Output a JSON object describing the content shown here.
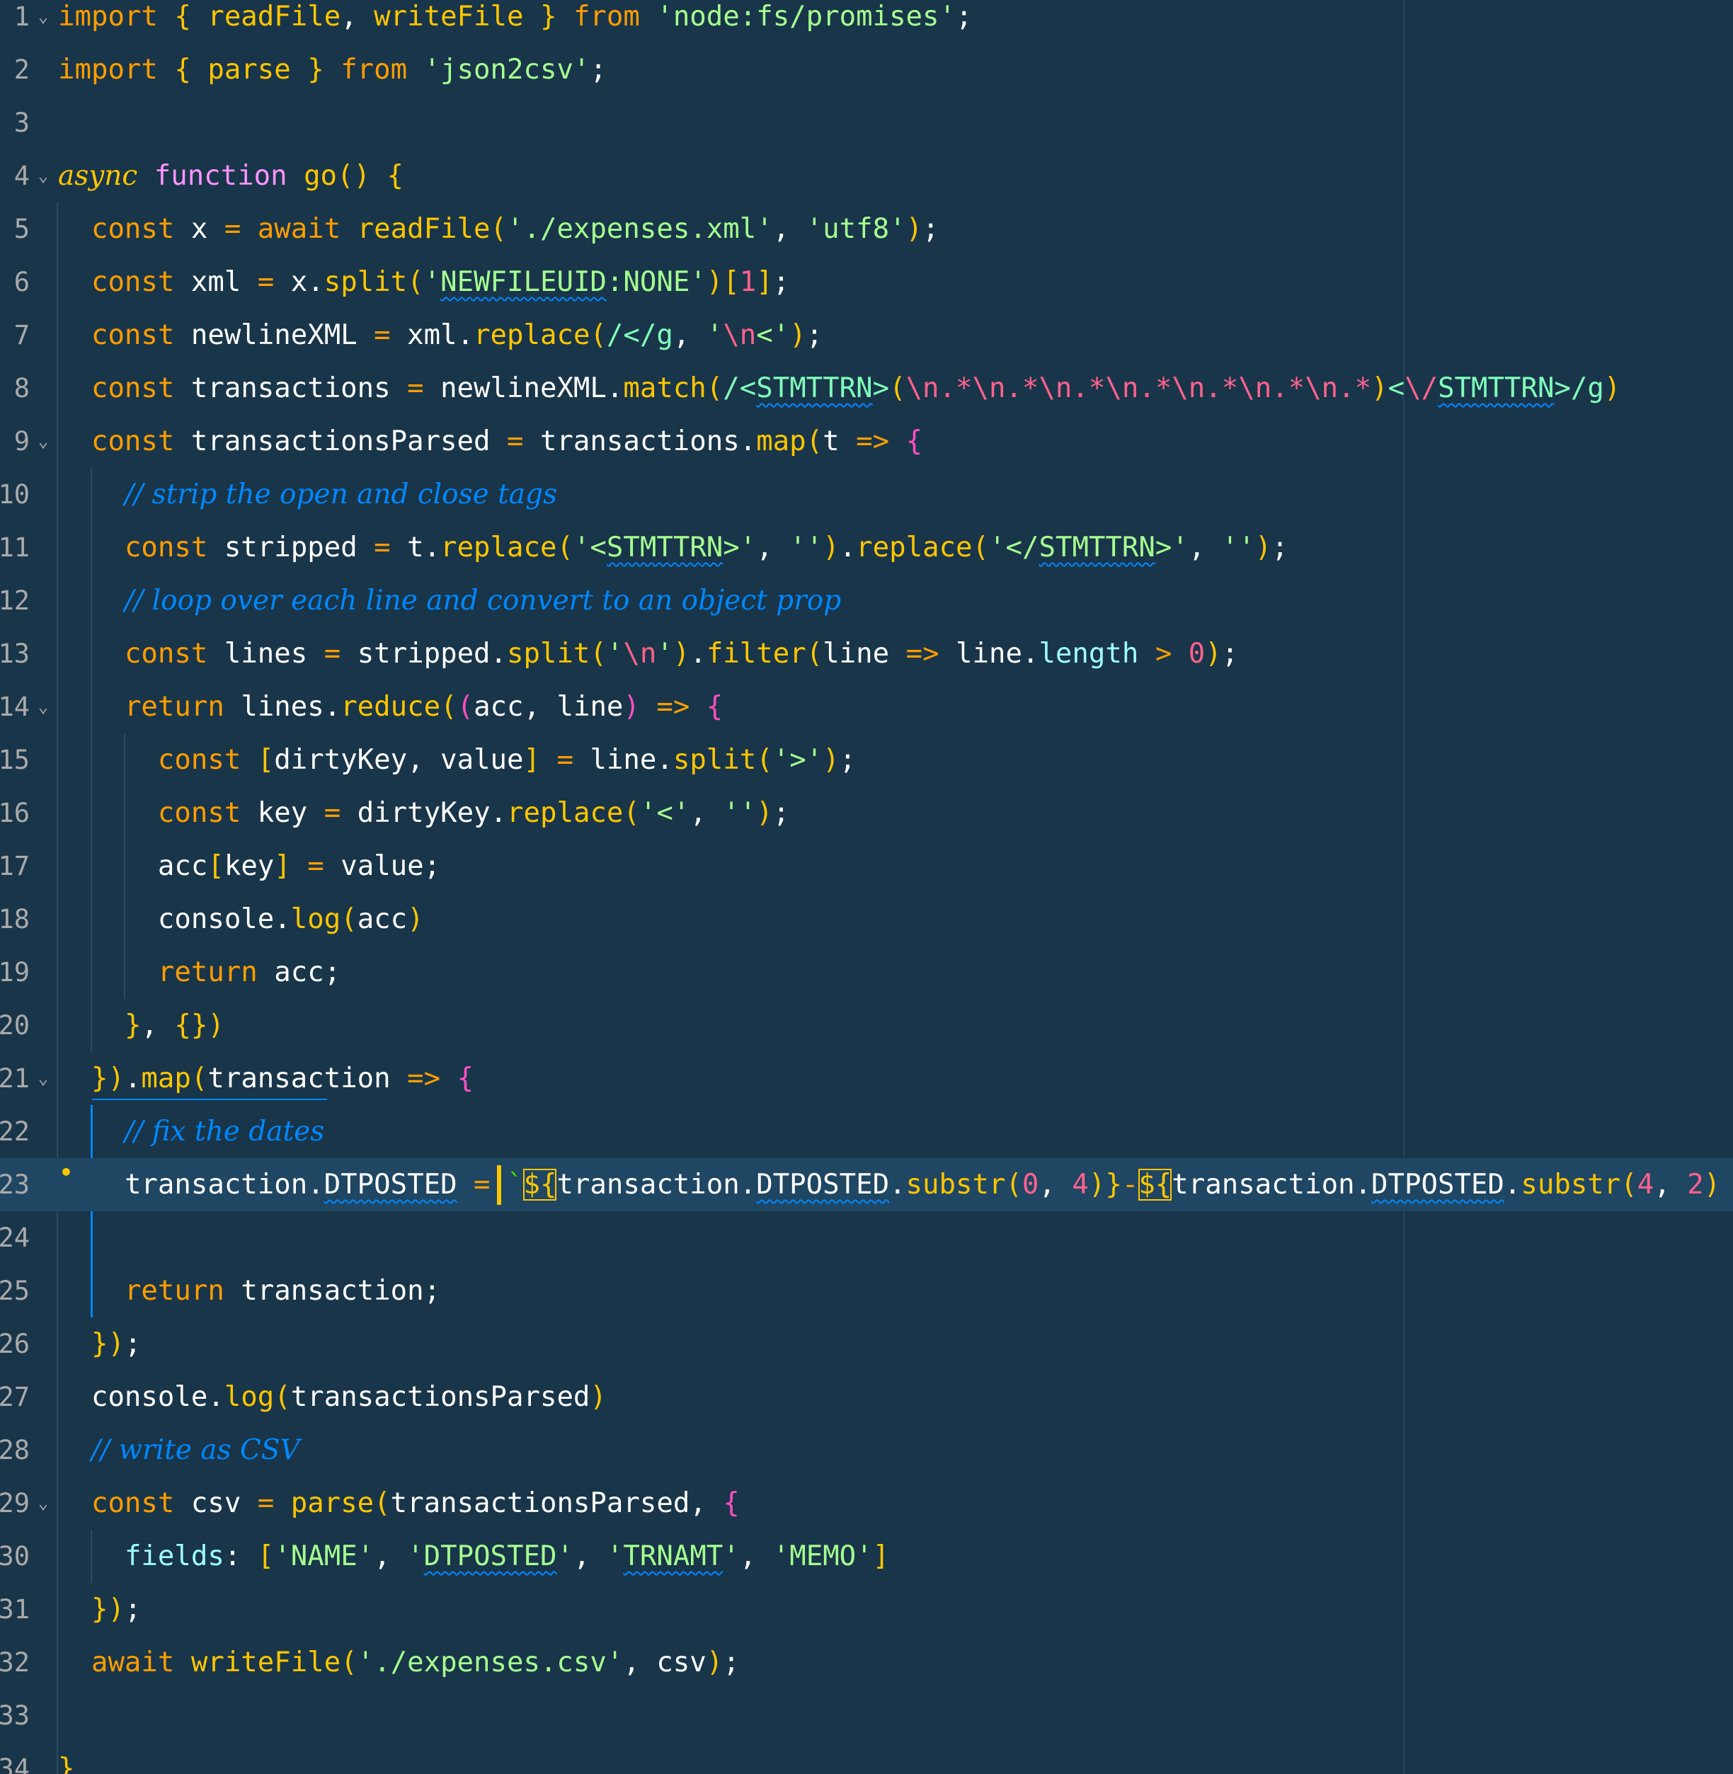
{
  "editor": {
    "language": "javascript",
    "cursor_line": 23,
    "lines": [
      {
        "n": "1",
        "fold": true,
        "code": "import { readFile, writeFile } from 'node:fs/promises';"
      },
      {
        "n": "2",
        "fold": false,
        "code": "import { parse } from 'json2csv';"
      },
      {
        "n": "3",
        "fold": false,
        "code": ""
      },
      {
        "n": "4",
        "fold": true,
        "code": "async function go() {"
      },
      {
        "n": "5",
        "fold": false,
        "code": "  const x = await readFile('./expenses.xml', 'utf8');"
      },
      {
        "n": "6",
        "fold": false,
        "code": "  const xml = x.split('NEWFILEUID:NONE')[1];"
      },
      {
        "n": "7",
        "fold": false,
        "code": "  const newlineXML = xml.replace(/</g, '\\n<');"
      },
      {
        "n": "8",
        "fold": false,
        "code": "  const transactions = newlineXML.match(/<STMTTRN>(\\n.*\\n.*\\n.*\\n.*\\n.*\\n.*\\n.*)<\\/STMTTRN>/g)"
      },
      {
        "n": "9",
        "fold": true,
        "code": "  const transactionsParsed = transactions.map(t => {"
      },
      {
        "n": "10",
        "fold": false,
        "code": "    // strip the open and close tags"
      },
      {
        "n": "11",
        "fold": false,
        "code": "    const stripped = t.replace('<STMTTRN>', '').replace('</STMTTRN>', '');"
      },
      {
        "n": "12",
        "fold": false,
        "code": "    // loop over each line and convert to an object prop"
      },
      {
        "n": "13",
        "fold": false,
        "code": "    const lines = stripped.split('\\n').filter(line => line.length > 0);"
      },
      {
        "n": "14",
        "fold": true,
        "code": "    return lines.reduce((acc, line) => {"
      },
      {
        "n": "15",
        "fold": false,
        "code": "      const [dirtyKey, value] = line.split('>');"
      },
      {
        "n": "16",
        "fold": false,
        "code": "      const key = dirtyKey.replace('<', '');"
      },
      {
        "n": "17",
        "fold": false,
        "code": "      acc[key] = value;"
      },
      {
        "n": "18",
        "fold": false,
        "code": "      console.log(acc)"
      },
      {
        "n": "19",
        "fold": false,
        "code": "      return acc;"
      },
      {
        "n": "20",
        "fold": false,
        "code": "    }, {})"
      },
      {
        "n": "21",
        "fold": true,
        "code": "  }).map(transaction => {"
      },
      {
        "n": "22",
        "fold": false,
        "code": "    // fix the dates"
      },
      {
        "n": "23",
        "fold": false,
        "code": "    transaction.DTPOSTED = `${transaction.DTPOSTED.substr(0, 4)}-${transaction.DTPOSTED.substr(4, 2)"
      },
      {
        "n": "24",
        "fold": false,
        "code": ""
      },
      {
        "n": "25",
        "fold": false,
        "code": "    return transaction;"
      },
      {
        "n": "26",
        "fold": false,
        "code": "  });"
      },
      {
        "n": "27",
        "fold": false,
        "code": "  console.log(transactionsParsed)"
      },
      {
        "n": "28",
        "fold": false,
        "code": "  // write as CSV"
      },
      {
        "n": "29",
        "fold": true,
        "code": "  const csv = parse(transactionsParsed, {"
      },
      {
        "n": "30",
        "fold": false,
        "code": "    fields: ['NAME', 'DTPOSTED', 'TRNAMT', 'MEMO']"
      },
      {
        "n": "31",
        "fold": false,
        "code": "  });"
      },
      {
        "n": "32",
        "fold": false,
        "code": "  await writeFile('./expenses.csv', csv);"
      },
      {
        "n": "33",
        "fold": false,
        "code": ""
      },
      {
        "n": "34",
        "fold": false,
        "code": "}"
      }
    ]
  },
  "colors": {
    "background": "#193549",
    "active_line": "#1f4662",
    "keyword": "#ff9d00",
    "function": "#ffc600",
    "string": "#a5ff90",
    "comment": "#0088ff",
    "number": "#ff628c"
  }
}
